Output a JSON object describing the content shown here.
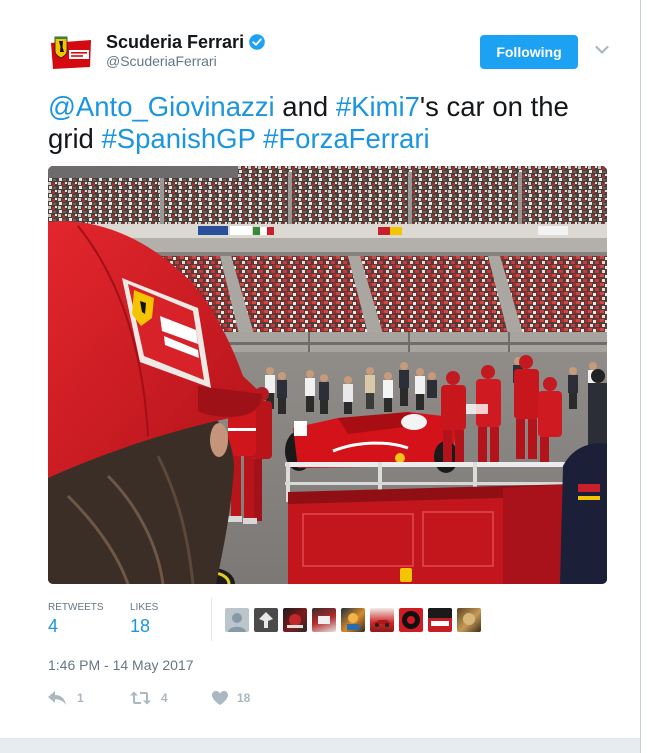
{
  "colors": {
    "link": "#1b95e0",
    "button_bg": "#1da1f2",
    "muted_text": "#657786",
    "icon": "#aab8c2",
    "text": "#14171a"
  },
  "tweet": {
    "author": {
      "name": "Scuderia Ferrari",
      "handle": "@ScuderiaFerrari",
      "avatar_icon": "ferrari-logo-icon",
      "verified_icon": "verified-badge-icon"
    },
    "follow_button": {
      "label": "Following"
    },
    "more_menu_icon": "chevron-down-icon",
    "text": [
      {
        "text": "@Anto_Giovinazzi"
      },
      {
        "text": " and "
      },
      {
        "text": "#Kimi7"
      },
      {
        "text": "'s car on the grid "
      },
      {
        "text": "#SpanishGP"
      },
      {
        "text": " "
      },
      {
        "text": "#ForzaFerrari"
      }
    ],
    "stats": {
      "retweets_label": "RETWEETS",
      "retweets_count": "4",
      "likes_label": "LIKES",
      "likes_count": "18"
    },
    "timestamp": "1:46 PM - 14 May 2017",
    "actions": {
      "reply_icon": "reply-icon",
      "reply_count": "1",
      "retweet_icon": "retweet-icon",
      "retweet_count": "4",
      "like_icon": "heart-icon",
      "like_count": "18"
    }
  }
}
